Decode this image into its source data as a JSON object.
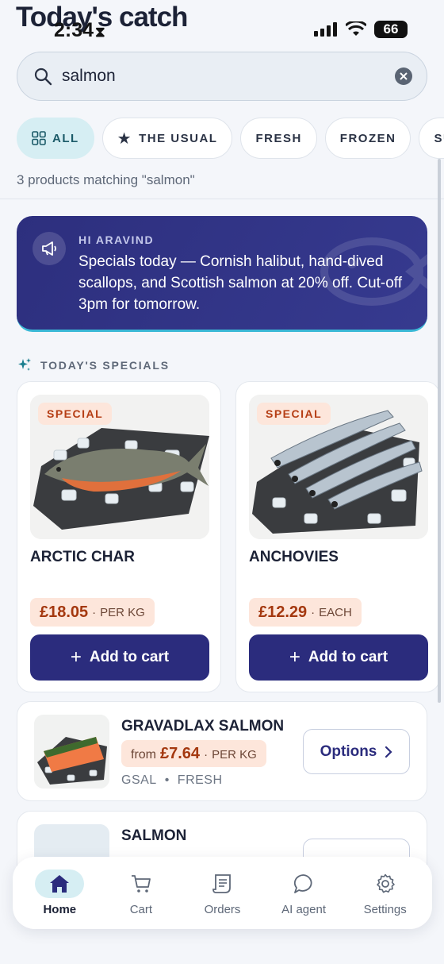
{
  "header": {
    "title": "Today's catch",
    "status_time": "2:34",
    "battery": "66"
  },
  "search": {
    "value": "salmon",
    "placeholder": "Search"
  },
  "chips": [
    {
      "label": "ALL",
      "icon": "grid-icon",
      "active": true
    },
    {
      "label": "THE USUAL",
      "icon": "star-icon"
    },
    {
      "label": "FRESH"
    },
    {
      "label": "FROZEN"
    },
    {
      "label": "SUNDRIES"
    }
  ],
  "results_count": "3 products matching \"salmon\"",
  "banner": {
    "greeting": "HI ARAVIND",
    "message": "Specials today — Cornish halibut, hand-dived scallops, and Scottish salmon at 20% off. Cut-off 3pm for tomorrow.",
    "icon": "megaphone-icon"
  },
  "specials": {
    "title": "TODAY'S SPECIALS",
    "items": [
      {
        "tag": "SPECIAL",
        "name": "ARCTIC CHAR",
        "price": "£18.05",
        "unit": "PER KG",
        "button": "Add to cart"
      },
      {
        "tag": "SPECIAL",
        "name": "ANCHOVIES",
        "price": "£12.29",
        "unit": "EACH",
        "button": "Add to cart"
      }
    ]
  },
  "products": [
    {
      "name": "GRAVADLAX SALMON",
      "from": "from",
      "price": "£7.64",
      "unit": "PER KG",
      "code": "GSAL",
      "category": "FRESH",
      "button": "Options"
    },
    {
      "name": "SALMON"
    }
  ],
  "nav": [
    {
      "label": "Home",
      "icon": "home-icon",
      "active": true
    },
    {
      "label": "Cart",
      "icon": "cart-icon"
    },
    {
      "label": "Orders",
      "icon": "receipt-icon"
    },
    {
      "label": "AI agent",
      "icon": "chat-icon"
    },
    {
      "label": "Settings",
      "icon": "gear-icon"
    }
  ],
  "colors": {
    "primary": "#2b2c7d",
    "accent_teal": "#d6eef3",
    "special_bg": "#fde6db",
    "special_text": "#b53d14"
  }
}
